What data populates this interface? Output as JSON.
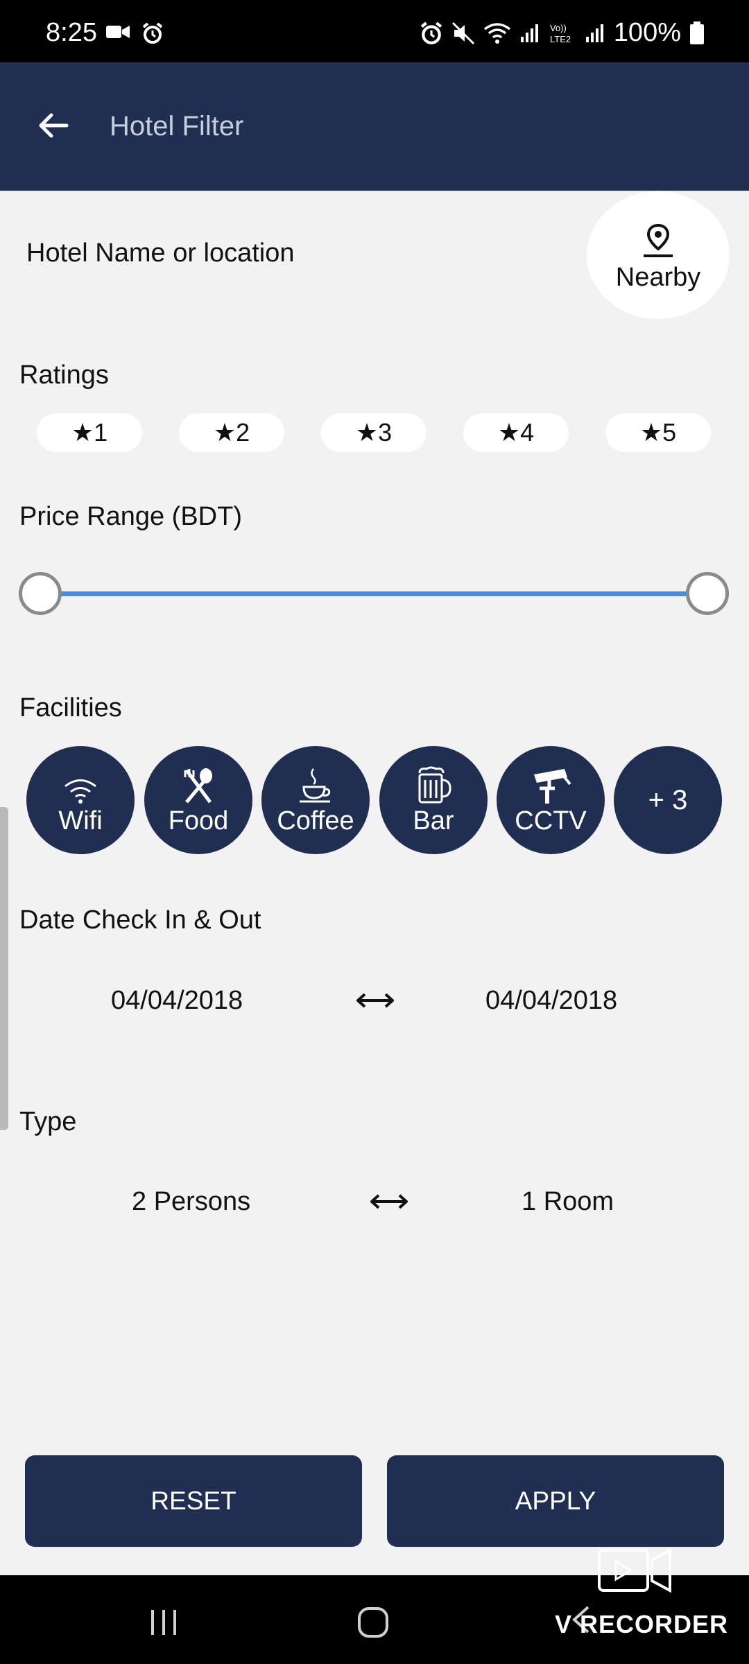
{
  "status_bar": {
    "time": "8:25",
    "battery": "100%"
  },
  "app_bar": {
    "title": "Hotel Filter"
  },
  "search": {
    "label": "Hotel Name or location",
    "nearby_label": "Nearby"
  },
  "ratings": {
    "label": "Ratings",
    "options": [
      "★1",
      "★2",
      "★3",
      "★4",
      "★5"
    ]
  },
  "price": {
    "label": "Price Range (BDT)",
    "range_fraction": [
      0,
      1
    ]
  },
  "facilities": {
    "label": "Facilities",
    "items": [
      "Wifi",
      "Food",
      "Coffee",
      "Bar",
      "CCTV"
    ],
    "more_label": "+ 3"
  },
  "dates": {
    "label": "Date Check In & Out",
    "check_in": "04/04/2018",
    "check_out": "04/04/2018"
  },
  "type": {
    "label": "Type",
    "persons": "2 Persons",
    "rooms": "1 Room"
  },
  "actions": {
    "reset": "RESET",
    "apply": "APPLY"
  },
  "watermark": {
    "text": "V RECORDER"
  },
  "colors": {
    "primary": "#1f2e51",
    "slider": "#3f8ee8",
    "background": "#f2f2f2"
  }
}
